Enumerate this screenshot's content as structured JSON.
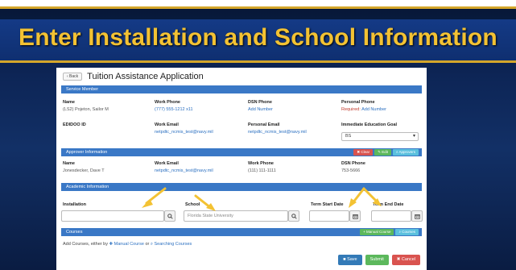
{
  "slide": {
    "title": "Enter Installation and School Information"
  },
  "app": {
    "back_label": "‹ Back",
    "title": "Tuition Assistance Application",
    "service_member": {
      "section_label": "Service Member",
      "name_label": "Name",
      "name_value": "(LS2) Pojeton, Sailor M",
      "work_phone_label": "Work Phone",
      "work_phone_value": "(777) 555-1212 x11",
      "dsn_phone_label": "DSN Phone",
      "dsn_phone_value": "Add Number",
      "personal_phone_label": "Personal Phone",
      "personal_phone_required": "Required:",
      "personal_phone_add": "Add Number",
      "edipi_label": "EDIDOO ID",
      "work_email_label": "Work Email",
      "work_email_value": "netpdtc_ncmis_test@navy.mil",
      "personal_email_label": "Personal Email",
      "personal_email_value": "netpdtc_ncmis_test@navy.mil",
      "edu_goal_label": "Immediate Education Goal",
      "edu_goal_value": "BS"
    },
    "approver": {
      "section_label": "Approver Information",
      "btn_clear": "✖ Clear",
      "btn_edit": "✎ Edit",
      "btn_approvers": "⌕ Approvers",
      "name_label": "Name",
      "name_value": "Jonesdecker, Dave T",
      "work_email_label": "Work Email",
      "work_email_value": "netpdtc_ncmis_test@navy.mil",
      "work_phone_label": "Work Phone",
      "work_phone_value": "(111) 111-1111",
      "dsn_phone_label": "DSN Phone",
      "dsn_phone_value": "753-5666"
    },
    "academic": {
      "section_label": "Academic Information",
      "installation_label": "Installation",
      "installation_value": "",
      "school_label": "School",
      "school_value": "Florida State University",
      "term_start_label": "Term Start Date",
      "term_end_label": "Term End Date"
    },
    "courses": {
      "section_label": "Courses",
      "btn_manual": "+ Manual Course",
      "btn_courses": "⌕ Courses",
      "hint_prefix": "Add Courses, either by",
      "hint_manual": "✚ Manual Course",
      "hint_or": "or",
      "hint_search": "⌕ Searching Courses"
    },
    "footer": {
      "save": "■ Save",
      "submit": "Submit",
      "cancel": "✖ Cancel"
    }
  },
  "colors": {
    "accent_gold": "#f3c233",
    "section_blue": "#3a78c6",
    "banner_navy": "#143a86"
  }
}
